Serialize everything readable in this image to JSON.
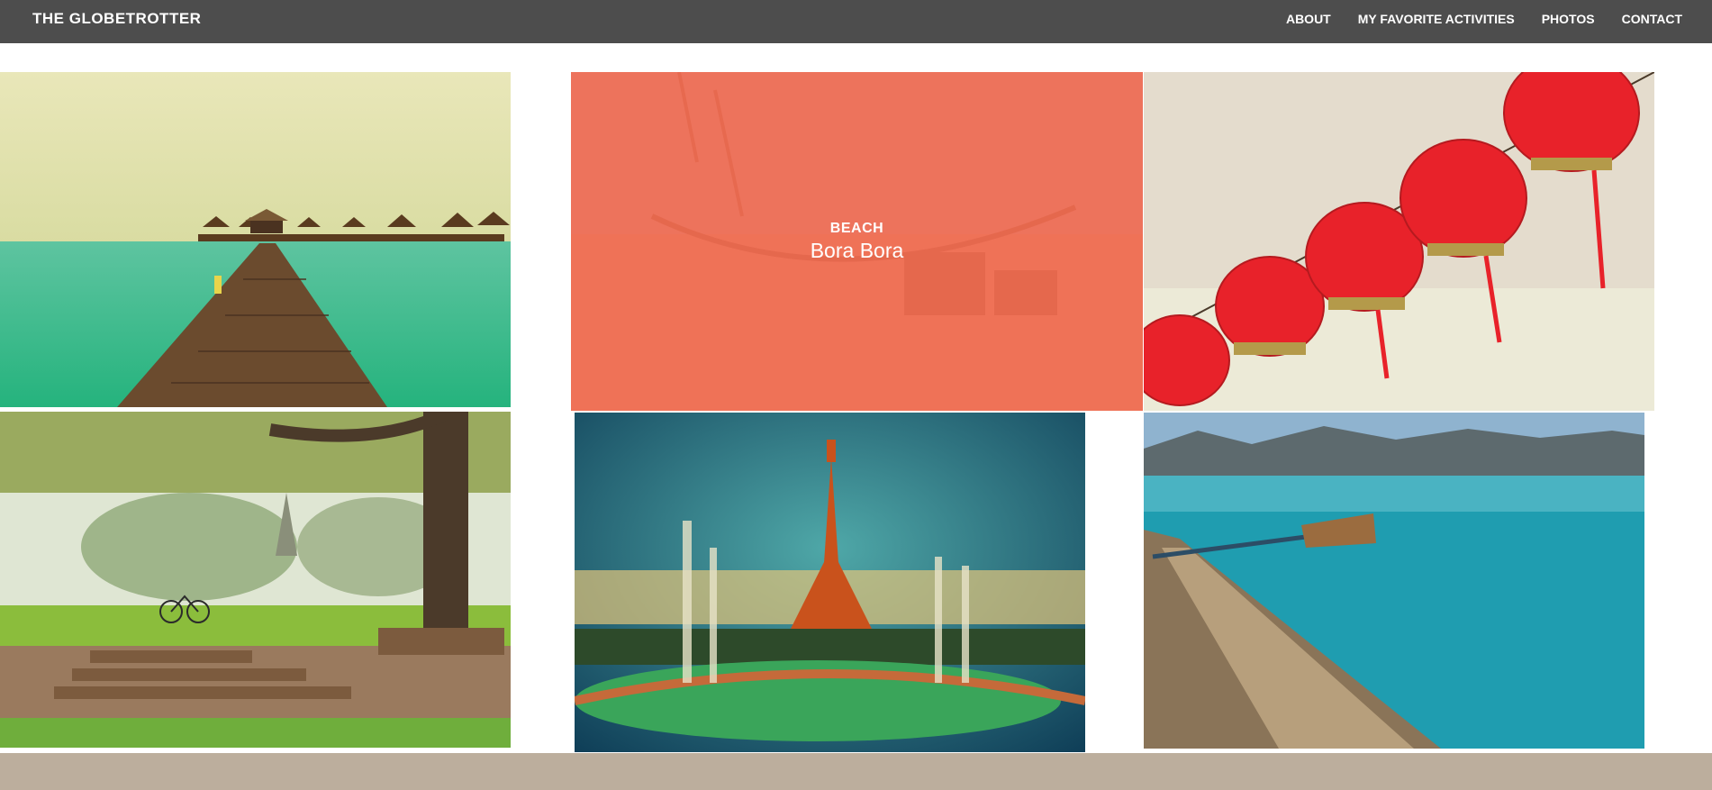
{
  "header": {
    "brand": "THE GLOBETROTTER",
    "nav": [
      "ABOUT",
      "MY FAVORITE ACTIVITIES",
      "PHOTOS",
      "CONTACT"
    ]
  },
  "gallery": {
    "tiles": [
      {
        "name": "overwater-pier"
      },
      {
        "name": "bora-bora",
        "category": "BEACH",
        "title": "Bora Bora"
      },
      {
        "name": "red-lanterns"
      },
      {
        "name": "temple-park"
      },
      {
        "name": "eiffel-tower"
      },
      {
        "name": "lake-paddle"
      }
    ]
  },
  "colors": {
    "navbar": "#4d4d4d",
    "overlay": "#f06a50",
    "footer": "#bcae9d"
  }
}
